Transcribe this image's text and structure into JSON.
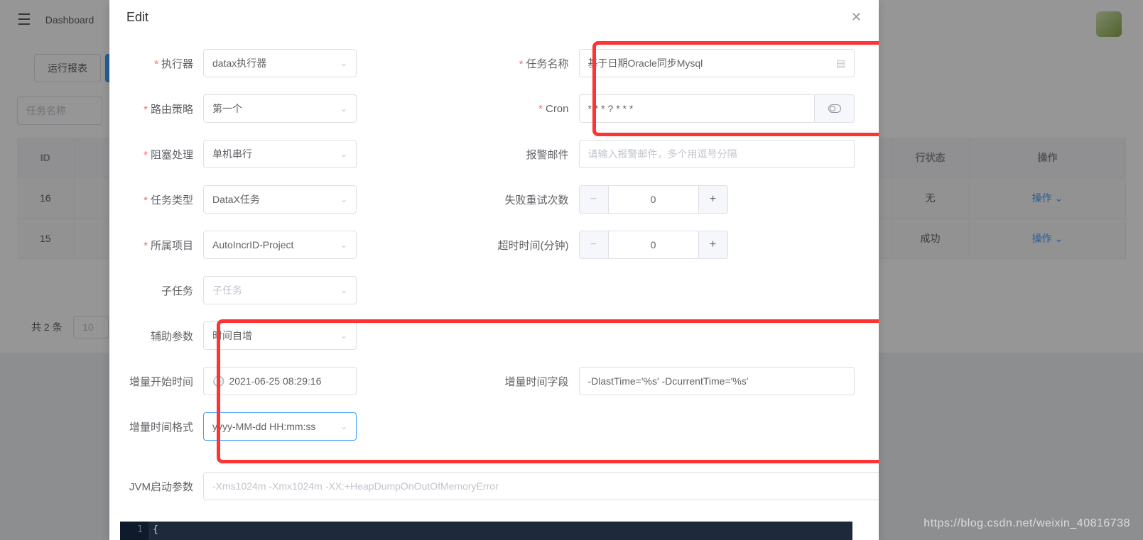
{
  "bg": {
    "breadcrumb": "Dashboard",
    "tabs": {
      "report": "运行报表"
    },
    "search": {
      "taskName": "任务名称"
    },
    "table": {
      "headers": {
        "id": "ID",
        "status": "行状态",
        "action": "操作"
      },
      "rows": [
        {
          "id": "16",
          "status": "无",
          "action": "操作"
        },
        {
          "id": "15",
          "status": "成功",
          "action": "操作"
        }
      ]
    },
    "foot": {
      "total": "共 2 条",
      "pagesize": "10"
    }
  },
  "modal": {
    "title": "Edit",
    "labels": {
      "executor": "执行器",
      "route": "路由策略",
      "block": "阻塞处理",
      "taskType": "任务类型",
      "project": "所属项目",
      "subtask": "子任务",
      "assist": "辅助参数",
      "incrStart": "增量开始时间",
      "incrFmt": "增量时间格式",
      "jvm": "JVM启动参数",
      "taskName": "任务名称",
      "cron": "Cron",
      "alarm": "报警邮件",
      "retry": "失败重试次数",
      "timeout": "超时时间(分钟)",
      "incrField": "增量时间字段"
    },
    "values": {
      "executor": "datax执行器",
      "route": "第一个",
      "block": "单机串行",
      "taskType": "DataX任务",
      "project": "AutoIncrID-Project",
      "subtask_ph": "子任务",
      "assist": "时间自增",
      "incrStart": "2021-06-25 08:29:16",
      "incrFmt": "yyyy-MM-dd HH:mm:ss",
      "jvm_ph": "-Xms1024m -Xmx1024m -XX:+HeapDumpOnOutOfMemoryError",
      "taskName": "基于日期Oracle同步Mysql",
      "cron": "* * * ? * * *",
      "alarm_ph": "请输入报警邮件，多个用逗号分隔",
      "retry": "0",
      "timeout": "0",
      "incrField": "-DlastTime='%s' -DcurrentTime='%s'"
    }
  },
  "code": {
    "line": "1",
    "text": "{"
  },
  "watermark": "https://blog.csdn.net/weixin_40816738"
}
